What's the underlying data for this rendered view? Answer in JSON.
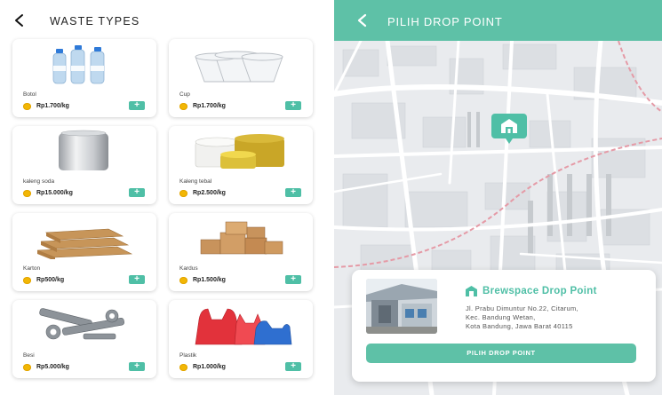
{
  "waste_screen": {
    "title": "WASTE TYPES",
    "items": [
      {
        "name": "Botol",
        "price": "Rp1.700/kg",
        "add": "+"
      },
      {
        "name": "Cup",
        "price": "Rp1.700/kg",
        "add": "+"
      },
      {
        "name": "kaleng soda",
        "price": "Rp15.000/kg",
        "add": "+"
      },
      {
        "name": "Kaleng tebal",
        "price": "Rp2.500/kg",
        "add": "+"
      },
      {
        "name": "Karton",
        "price": "Rp500/kg",
        "add": "+"
      },
      {
        "name": "Kardus",
        "price": "Rp1.500/kg",
        "add": "+"
      },
      {
        "name": "Besi",
        "price": "Rp5.000/kg",
        "add": "+"
      },
      {
        "name": "Plastik",
        "price": "Rp1.000/kg",
        "add": "+"
      }
    ]
  },
  "drop_screen": {
    "title": "PILIH DROP POINT",
    "card": {
      "name": "Brewspace Drop Point",
      "address_line1": "Jl. Prabu Dimuntur No.22, Citarum,",
      "address_line2": "Kec. Bandung Wetan,",
      "address_line3": "Kota Bandung, Jawa Barat 40115",
      "button": "PILIH DROP POINT"
    }
  },
  "colors": {
    "accent": "#5ec1a7",
    "coin": "#f2b705",
    "route": "#e59aa6"
  },
  "icons": [
    "back-arrow-icon",
    "coin-icon",
    "add-icon",
    "drop-point-marker-icon",
    "building-icon"
  ]
}
